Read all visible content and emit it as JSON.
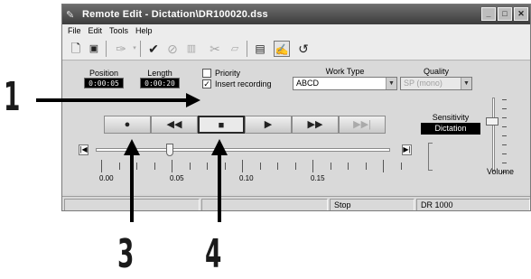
{
  "window": {
    "title": "Remote Edit - Dictation\\DR100020.dss",
    "title_icon": "pen-icon",
    "controls": [
      "_",
      "□",
      "✕"
    ]
  },
  "menu": [
    "File",
    "Edit",
    "Tools",
    "Help"
  ],
  "toolbar_icons": [
    "new-document-icon",
    "save-icon",
    "voice-recognition-icon",
    "dropdown-arrow-icon",
    "checkmark-icon",
    "no-entry-icon",
    "book-icon",
    "cut-icon",
    "paste-icon",
    "properties-icon",
    "remote-edit-icon",
    "undo-icon"
  ],
  "position": {
    "label": "Position",
    "value": "0:00:05"
  },
  "length": {
    "label": "Length",
    "value": "0:00:20"
  },
  "priority": {
    "label": "Priority",
    "checked": false
  },
  "insert_recording": {
    "label": "Insert recording",
    "checked": true
  },
  "work_type": {
    "label": "Work Type",
    "value": "ABCD"
  },
  "quality": {
    "label": "Quality",
    "value": "SP (mono)"
  },
  "sensitivity": {
    "label": "Sensitivity",
    "value": "Dictation"
  },
  "transport": {
    "record": "●",
    "rewind": "◀◀",
    "stop": "■",
    "play": "▶",
    "fast_forward": "▶▶",
    "skip_end": "▶▶|"
  },
  "seek": {
    "start_glyph": "|◀",
    "end_glyph": "▶|",
    "position_fraction": 0.25,
    "ticks": [
      "0.00",
      "0.05",
      "0.10",
      "0.15"
    ]
  },
  "volume": {
    "label": "Volume",
    "level_fraction": 0.72
  },
  "status": {
    "cell1": "",
    "cell2": "",
    "cell3": "Stop",
    "cell4": "DR 1000"
  },
  "callouts": {
    "n1": "1",
    "n3": "3",
    "n4": "4"
  },
  "colors": {
    "lcd_bg": "#000000",
    "lcd_fg": "#ffffff",
    "titlebar": "#4a4a4a",
    "arrow": "#000000"
  }
}
